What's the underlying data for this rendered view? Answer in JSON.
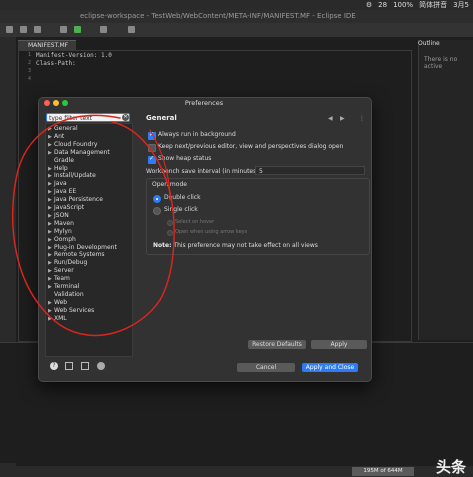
{
  "menubar": {
    "badge": "28",
    "battery": "100%",
    "ime": "简体拼音",
    "date": "3月5"
  },
  "window": {
    "title": "eclipse-workspace - TestWeb/WebContent/META-INF/MANIFEST.MF - Eclipse IDE"
  },
  "editor": {
    "tab_label": "MANIFEST.MF",
    "lines": [
      "Manifest-Version: 1.0",
      "Class-Path:",
      "",
      ""
    ],
    "line_numbers": [
      "1",
      "2",
      "3",
      "4"
    ]
  },
  "outline": {
    "tab_label": "Outline",
    "message": "There is no active"
  },
  "dialog": {
    "title": "Preferences",
    "filter_placeholder": "type filter text",
    "tree": [
      {
        "label": "General",
        "expandable": true
      },
      {
        "label": "Ant",
        "expandable": true
      },
      {
        "label": "Cloud Foundry",
        "expandable": true
      },
      {
        "label": "Data Management",
        "expandable": true
      },
      {
        "label": "Gradle",
        "expandable": false
      },
      {
        "label": "Help",
        "expandable": true
      },
      {
        "label": "Install/Update",
        "expandable": true
      },
      {
        "label": "Java",
        "expandable": true
      },
      {
        "label": "Java EE",
        "expandable": true
      },
      {
        "label": "Java Persistence",
        "expandable": true
      },
      {
        "label": "JavaScript",
        "expandable": true
      },
      {
        "label": "JSON",
        "expandable": true
      },
      {
        "label": "Maven",
        "expandable": true
      },
      {
        "label": "Mylyn",
        "expandable": true
      },
      {
        "label": "Oomph",
        "expandable": true
      },
      {
        "label": "Plug-in Development",
        "expandable": true
      },
      {
        "label": "Remote Systems",
        "expandable": true
      },
      {
        "label": "Run/Debug",
        "expandable": true
      },
      {
        "label": "Server",
        "expandable": true
      },
      {
        "label": "Team",
        "expandable": true
      },
      {
        "label": "Terminal",
        "expandable": true
      },
      {
        "label": "Validation",
        "expandable": false
      },
      {
        "label": "Web",
        "expandable": true
      },
      {
        "label": "Web Services",
        "expandable": true
      },
      {
        "label": "XML",
        "expandable": true
      }
    ],
    "page_title": "General",
    "options": [
      {
        "label": "Always run in background",
        "checked": true
      },
      {
        "label": "Keep next/previous editor, view and perspectives dialog open",
        "checked": false
      },
      {
        "label": "Show heap status",
        "checked": true
      }
    ],
    "save_interval_label": "Workbench save interval (in minutes):",
    "save_interval_value": "5",
    "open_mode": {
      "label": "Open mode",
      "double_click": "Double click",
      "single_click": "Single click",
      "sub1": "Select on hover",
      "sub2": "Open when using arrow keys"
    },
    "note_label": "Note:",
    "note_text": "This preference may not take effect on all views",
    "restore_defaults": "Restore Defaults",
    "apply": "Apply",
    "cancel": "Cancel",
    "apply_close": "Apply and Close"
  },
  "status": {
    "heap": "195M of 644M"
  },
  "watermark": "头条",
  "colors": {
    "accent": "#2d7cf6",
    "annotation": "#d8261e"
  }
}
